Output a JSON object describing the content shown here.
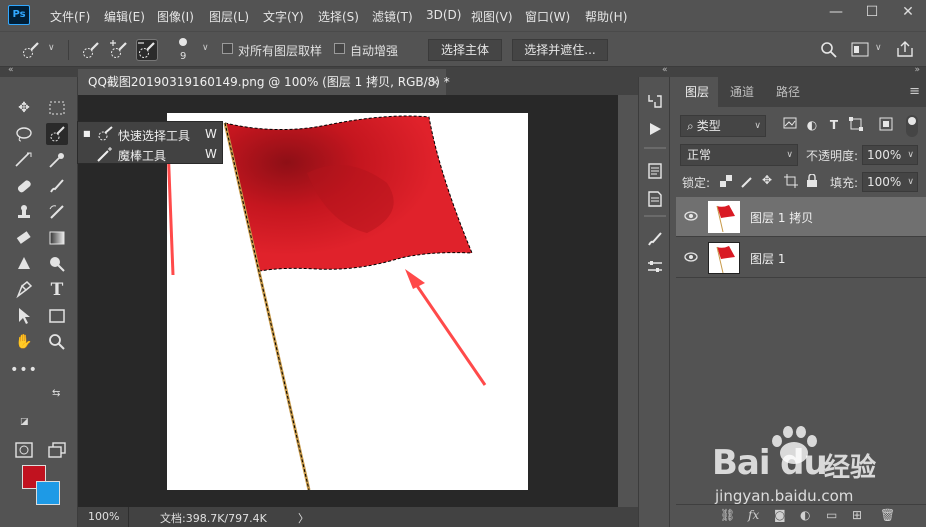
{
  "app": {
    "logo": "Ps"
  },
  "menu": [
    "文件(F)",
    "编辑(E)",
    "图像(I)",
    "图层(L)",
    "文字(Y)",
    "选择(S)",
    "滤镜(T)",
    "3D(D)",
    "视图(V)",
    "窗口(W)",
    "帮助(H)"
  ],
  "window_controls": {
    "minimize": "—",
    "maximize": "☐",
    "close": "✕"
  },
  "options": {
    "brush_size": "9",
    "sample_all_layers": "对所有图层取样",
    "auto_enhance": "自动增强",
    "select_subject": "选择主体",
    "select_and_mask": "选择并遮住..."
  },
  "document": {
    "tab_title": "QQ截图20190319160149.png @ 100% (图层 1 拷贝, RGB/8) *",
    "close_glyph": "×",
    "zoom": "100%",
    "doc_info": "文档:398.7K/797.4K",
    "status_arrow": "〉"
  },
  "flyout": [
    {
      "label": "快速选择工具",
      "key": "W",
      "active": true
    },
    {
      "label": "魔棒工具",
      "key": "W",
      "active": false
    }
  ],
  "layers_panel": {
    "tabs": [
      "图层",
      "通道",
      "路径"
    ],
    "filter_kind": "类型",
    "blend_mode": "正常",
    "opacity_label": "不透明度:",
    "opacity_value": "100%",
    "lock_label": "锁定:",
    "fill_label": "填充:",
    "fill_value": "100%",
    "layers": [
      {
        "name": "图层 1 拷贝",
        "selected": true
      },
      {
        "name": "图层 1",
        "selected": false
      }
    ]
  },
  "watermark": {
    "brand": "Bai",
    "brand_end": "du",
    "cn": "经验",
    "url": "jingyan.baidu.com"
  },
  "colors": {
    "foreground": "#c1121f",
    "background": "#1e9ae6",
    "arrow": "#ff4a4a",
    "flag": "#d91a24"
  }
}
